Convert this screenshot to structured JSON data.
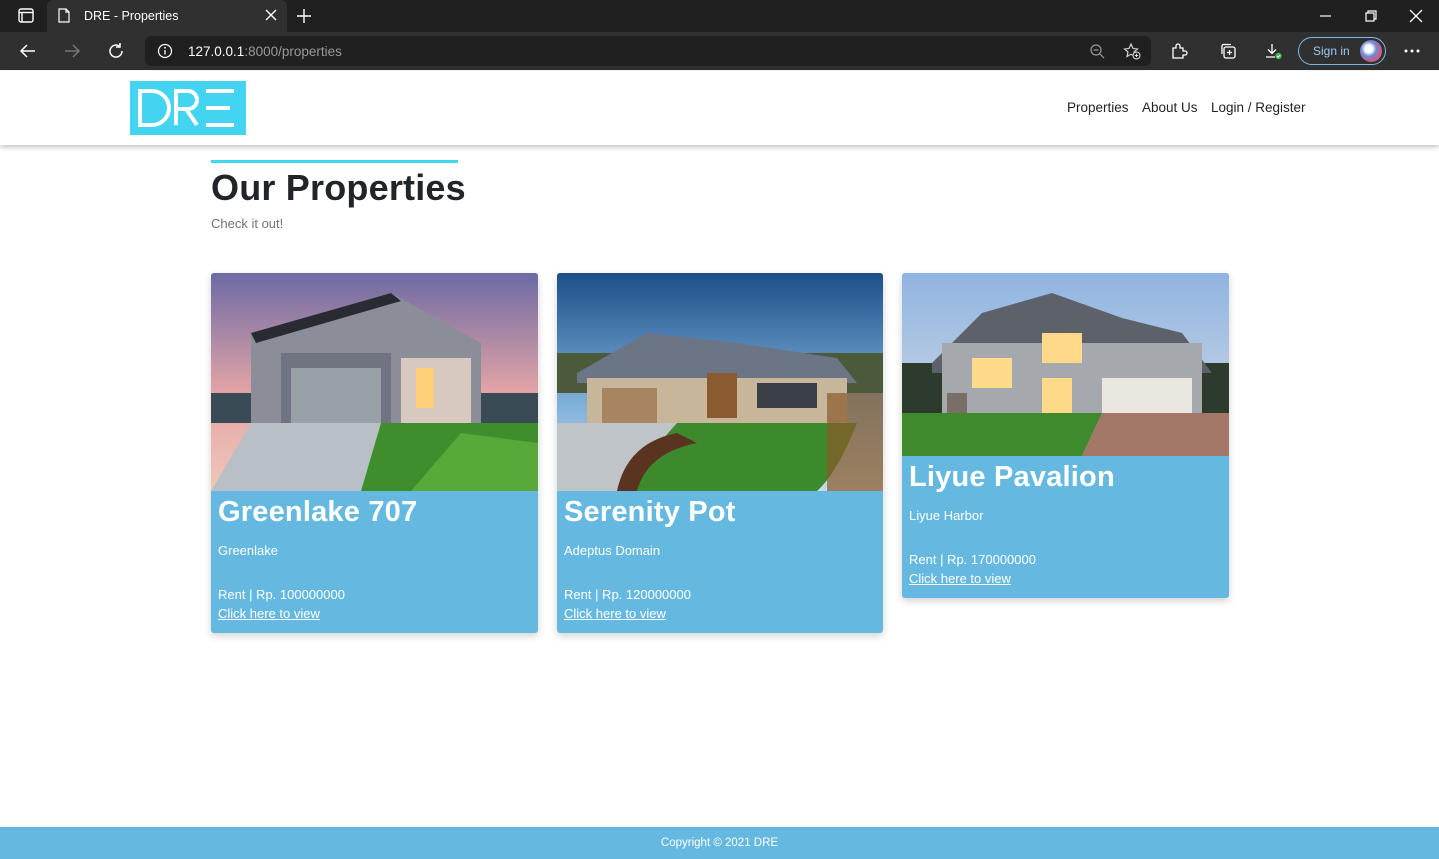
{
  "browser": {
    "tab_title": "DRE - Properties",
    "url_host": "127.0.0.1",
    "url_rest": ":8000/properties",
    "sign_in_label": "Sign in"
  },
  "site": {
    "logo_text": "DRE",
    "nav": [
      "Properties",
      "About Us",
      "Login / Register"
    ],
    "heading": "Our Properties",
    "subheading": "Check it out!",
    "footer": "Copyright © 2021 DRE"
  },
  "properties": [
    {
      "name": "Greenlake 707",
      "location": "Greenlake",
      "price": "Rent | Rp. 100000000",
      "link": "Click here to view"
    },
    {
      "name": "Serenity Pot",
      "location": "Adeptus Domain",
      "price": "Rent | Rp. 120000000",
      "link": "Click here to view"
    },
    {
      "name": "Liyue Pavalion",
      "location": "Liyue Harbor",
      "price": "Rent | Rp. 170000000",
      "link": "Click here to view"
    }
  ],
  "colors": {
    "accent": "#3fd6ee",
    "logo_bg": "#42d4f0",
    "card_bg": "#65b9e1",
    "footer_bg": "#65b9e1"
  }
}
